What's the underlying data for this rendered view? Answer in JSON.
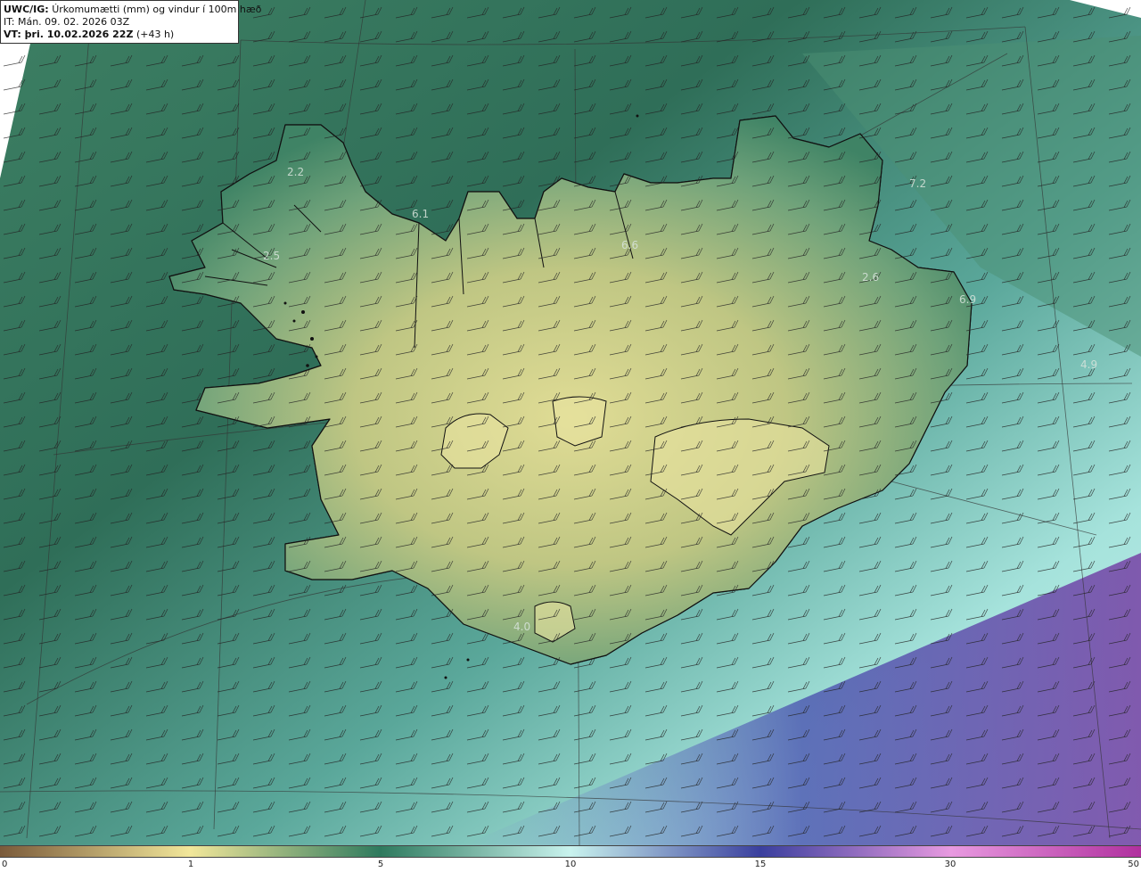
{
  "header": {
    "model": "UWC/IG:",
    "title": "Úrkomumætti (mm) og vindur í 100m hæð",
    "issue_time": "IT: Mán. 09. 02. 2026 03Z",
    "valid_label": "VT: þri. 10.02.2026 22Z",
    "lead_time": "(+43 h)"
  },
  "labels": [
    {
      "text": "2.2"
    },
    {
      "text": "6.1"
    },
    {
      "text": "2.5"
    },
    {
      "text": "6.6"
    },
    {
      "text": "7.2"
    },
    {
      "text": "2.6"
    },
    {
      "text": "6.9"
    },
    {
      "text": "4.9"
    },
    {
      "text": "4.0"
    }
  ],
  "colorbar": {
    "ticks": [
      "0",
      "1",
      "5",
      "10",
      "15",
      "30",
      "50"
    ],
    "stops": [
      "#7a5a3a",
      "#f2e79a",
      "#2e7a5e",
      "#c9f3ee",
      "#3a3f9e",
      "#e89ae0",
      "#b0309e"
    ]
  },
  "colors": {
    "ocean_dark": "#2f6e58",
    "ocean_light": "#7ec8bf",
    "land_light": "#d9d88e",
    "coast": "#111111"
  }
}
